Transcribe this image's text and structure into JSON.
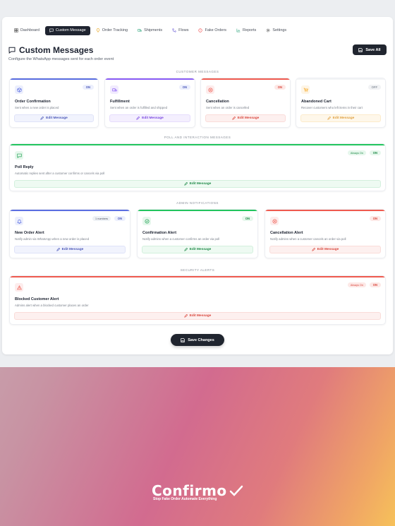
{
  "nav": {
    "items": [
      {
        "label": "Dashboard",
        "icon": "grid-icon"
      },
      {
        "label": "Custom Message",
        "icon": "message-icon",
        "active": true
      },
      {
        "label": "Order Tracking",
        "icon": "location-icon"
      },
      {
        "label": "Shipments",
        "icon": "truck-icon"
      },
      {
        "label": "Flows",
        "icon": "flow-icon"
      },
      {
        "label": "Fake Orders",
        "icon": "alert-icon"
      },
      {
        "label": "Reports",
        "icon": "chart-icon"
      },
      {
        "label": "Settings",
        "icon": "gear-icon"
      }
    ]
  },
  "header": {
    "title": "Custom Messages",
    "subtitle": "Configure the WhatsApp messages sent for each order event",
    "save_all_label": "Save All"
  },
  "sections": {
    "customer": "CUSTOMER MESSAGES",
    "poll": "POLL AND INTERACTION MESSAGES",
    "admin": "ADMIN NOTIFICATIONS",
    "security": "SECURITY ALERTS"
  },
  "customer_cards": [
    {
      "title": "Order Confirmation",
      "desc": "Sent when a new order is placed",
      "toggle": "ON",
      "edit": "Edit Message",
      "color": "#5b6ee1"
    },
    {
      "title": "Fulfillment",
      "desc": "Sent when an order is fulfilled and shipped",
      "toggle": "ON",
      "edit": "Edit Message",
      "color": "#8b5cf6"
    },
    {
      "title": "Cancellation",
      "desc": "Sent when an order is cancelled",
      "toggle": "ON",
      "edit": "Edit Message",
      "color": "#ef5a4f"
    },
    {
      "title": "Abandoned Cart",
      "desc": "Recover customers who left items in their cart",
      "toggle": "OFF",
      "edit": "Edit Message",
      "color": "#f59e0b"
    }
  ],
  "poll_card": {
    "title": "Poll Reply",
    "desc": "Automatic replies sent after a customer confirms or cancels via poll",
    "chip": "Always On",
    "toggle": "ON",
    "edit": "Edit Message",
    "color": "#22c55e"
  },
  "admin_cards": [
    {
      "title": "New Order Alert",
      "desc": "Notify admin via WhatsApp when a new order is placed",
      "chip": "1 numbers",
      "toggle": "ON",
      "edit": "Edit Message",
      "color": "#5b6ee1"
    },
    {
      "title": "Confirmation Alert",
      "desc": "Notify admins when a customer confirms an order via poll",
      "toggle": "ON",
      "edit": "Edit Message",
      "color": "#22c55e"
    },
    {
      "title": "Cancellation Alert",
      "desc": "Notify admins when a customer cancels an order via poll",
      "toggle": "ON",
      "edit": "Edit Message",
      "color": "#ef5a4f"
    }
  ],
  "security_card": {
    "title": "Blocked Customer Alert",
    "desc": "Admins alert when a blocked customer places an order",
    "chip": "Always On",
    "toggle": "ON",
    "edit": "Edit Message",
    "color": "#ef5a4f"
  },
  "footer": {
    "save_changes_label": "Save Changes"
  },
  "brand": {
    "name": "Confirmo",
    "tagline": "Stop Fake Order Automate Everything"
  }
}
